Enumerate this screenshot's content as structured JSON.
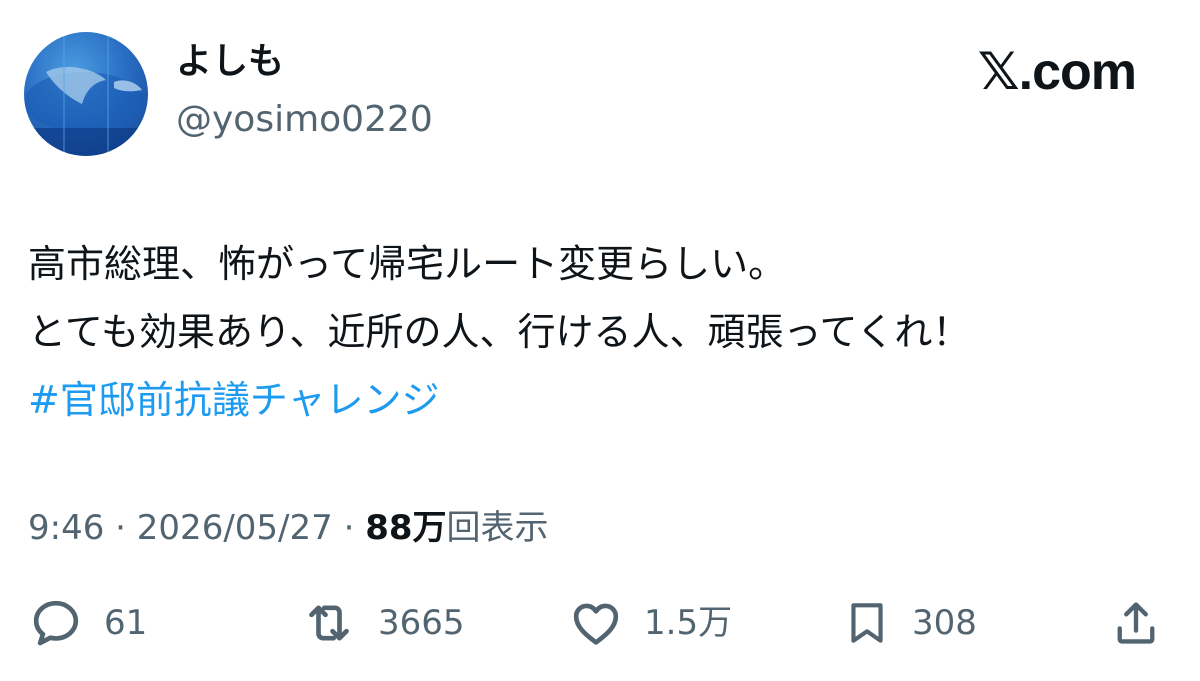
{
  "author": {
    "display_name": "よしも",
    "handle": "@yosimo0220",
    "avatar_icon": "aquarium-avatar"
  },
  "site": {
    "logo_text": "𝕏.com"
  },
  "tweet": {
    "lines": [
      "高市総理、怖がって帰宅ルート変更らしい。",
      "とても効果あり、近所の人、行ける人、頑張ってくれ！"
    ],
    "hashtag": "#官邸前抗議チャレンジ"
  },
  "meta": {
    "time": "9:46",
    "separator": " · ",
    "date": "2026/05/27",
    "views_count": "88万",
    "views_label": "回表示"
  },
  "actions": {
    "reply": {
      "icon": "reply-icon",
      "count": "61"
    },
    "retweet": {
      "icon": "retweet-icon",
      "count": "3665"
    },
    "like": {
      "icon": "heart-icon",
      "count": "1.5万"
    },
    "bookmark": {
      "icon": "bookmark-icon",
      "count": "308"
    },
    "share": {
      "icon": "share-icon"
    }
  },
  "colors": {
    "text_primary": "#0f1419",
    "text_secondary": "#536471",
    "link": "#1d9bf0",
    "icon": "#536471"
  }
}
